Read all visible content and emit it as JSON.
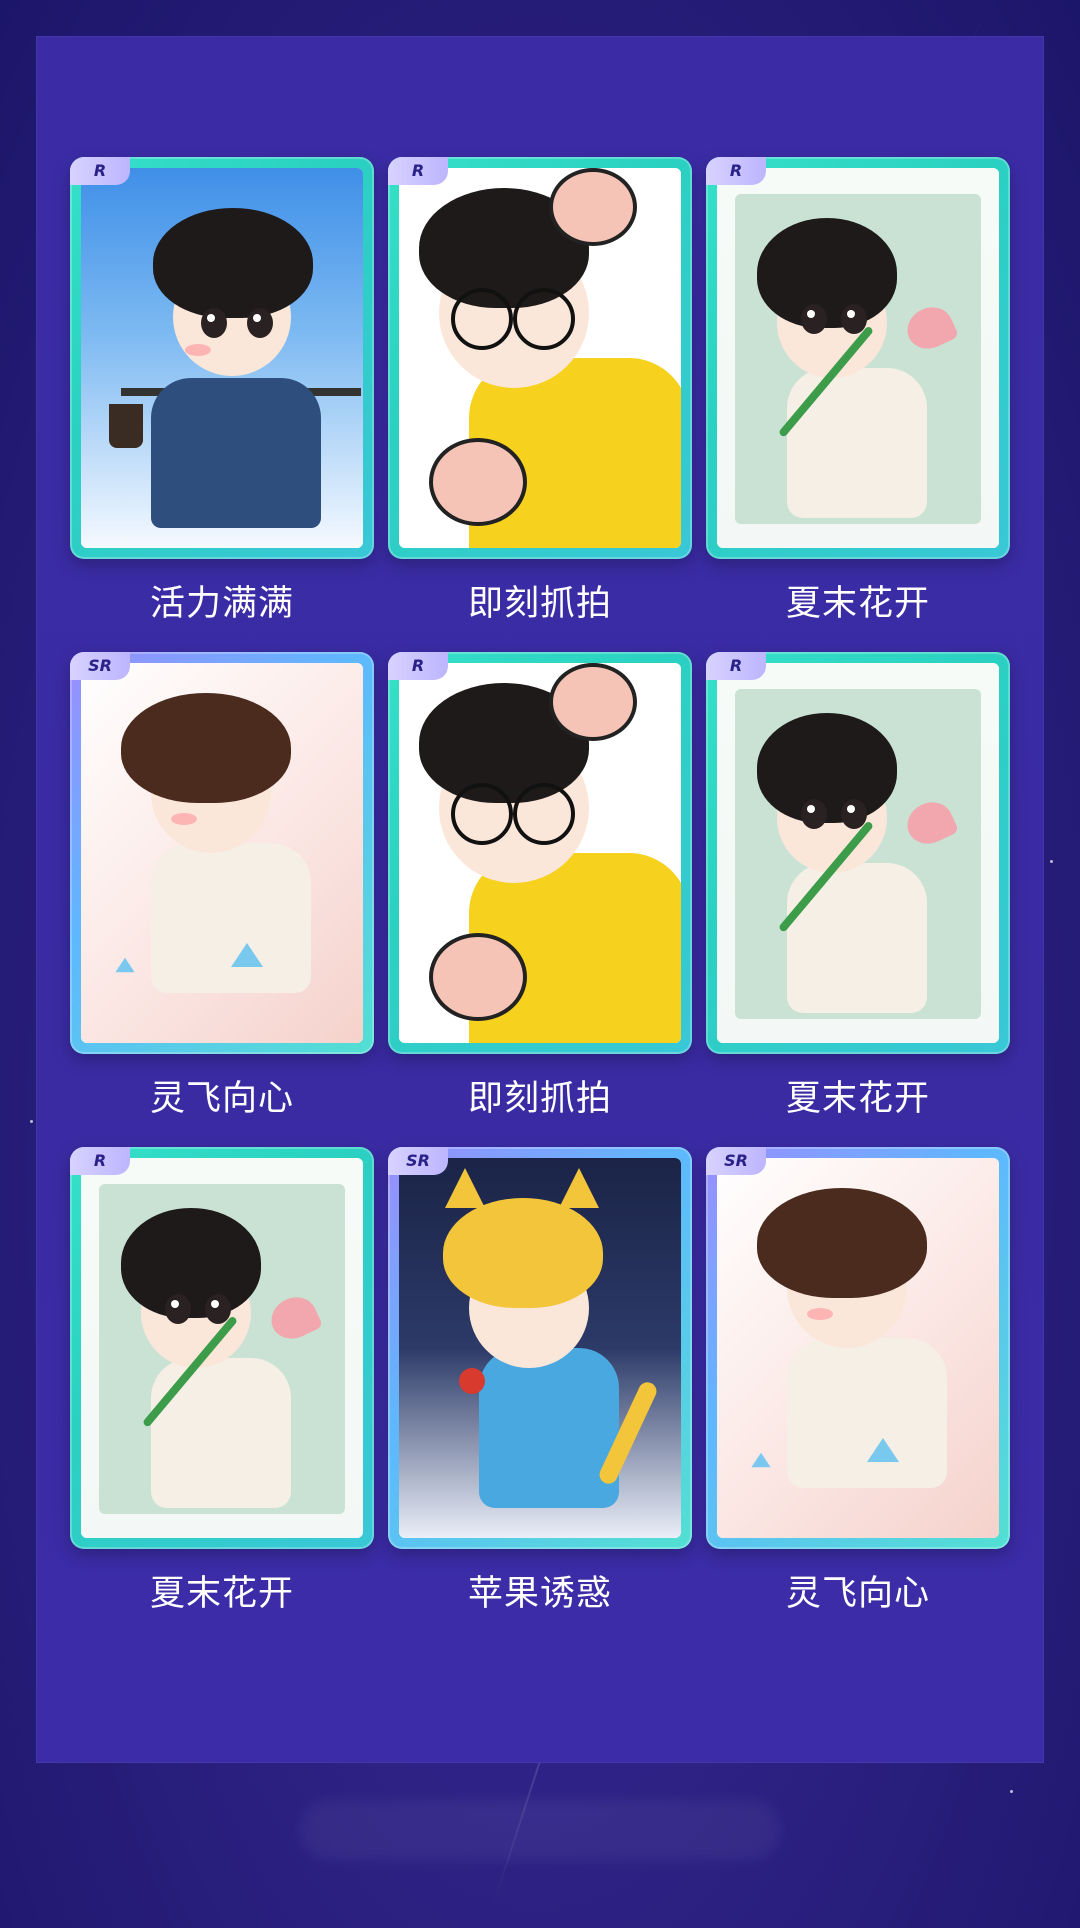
{
  "cards": [
    {
      "rarity": "R",
      "label": "活力满满",
      "art": "office-boy-coffee"
    },
    {
      "rarity": "R",
      "label": "即刻抓拍",
      "art": "glasses-boy-yellow"
    },
    {
      "rarity": "R",
      "label": "夏末花开",
      "art": "lotus-bun"
    },
    {
      "rarity": "SR",
      "label": "灵飞向心",
      "art": "butterfly-scholar"
    },
    {
      "rarity": "R",
      "label": "即刻抓拍",
      "art": "glasses-boy-yellow"
    },
    {
      "rarity": "R",
      "label": "夏末花开",
      "art": "lotus-bun"
    },
    {
      "rarity": "R",
      "label": "夏末花开",
      "art": "lotus-bun"
    },
    {
      "rarity": "SR",
      "label": "苹果诱惑",
      "art": "cat-ears-apple"
    },
    {
      "rarity": "SR",
      "label": "灵飞向心",
      "art": "butterfly-scholar"
    }
  ],
  "colors": {
    "background": "#2a1f7e",
    "panel": "#3b2ca6",
    "card_border_r": "#35e0c8",
    "card_border_sr": "#9b8cff",
    "label_text": "#ffffff"
  }
}
